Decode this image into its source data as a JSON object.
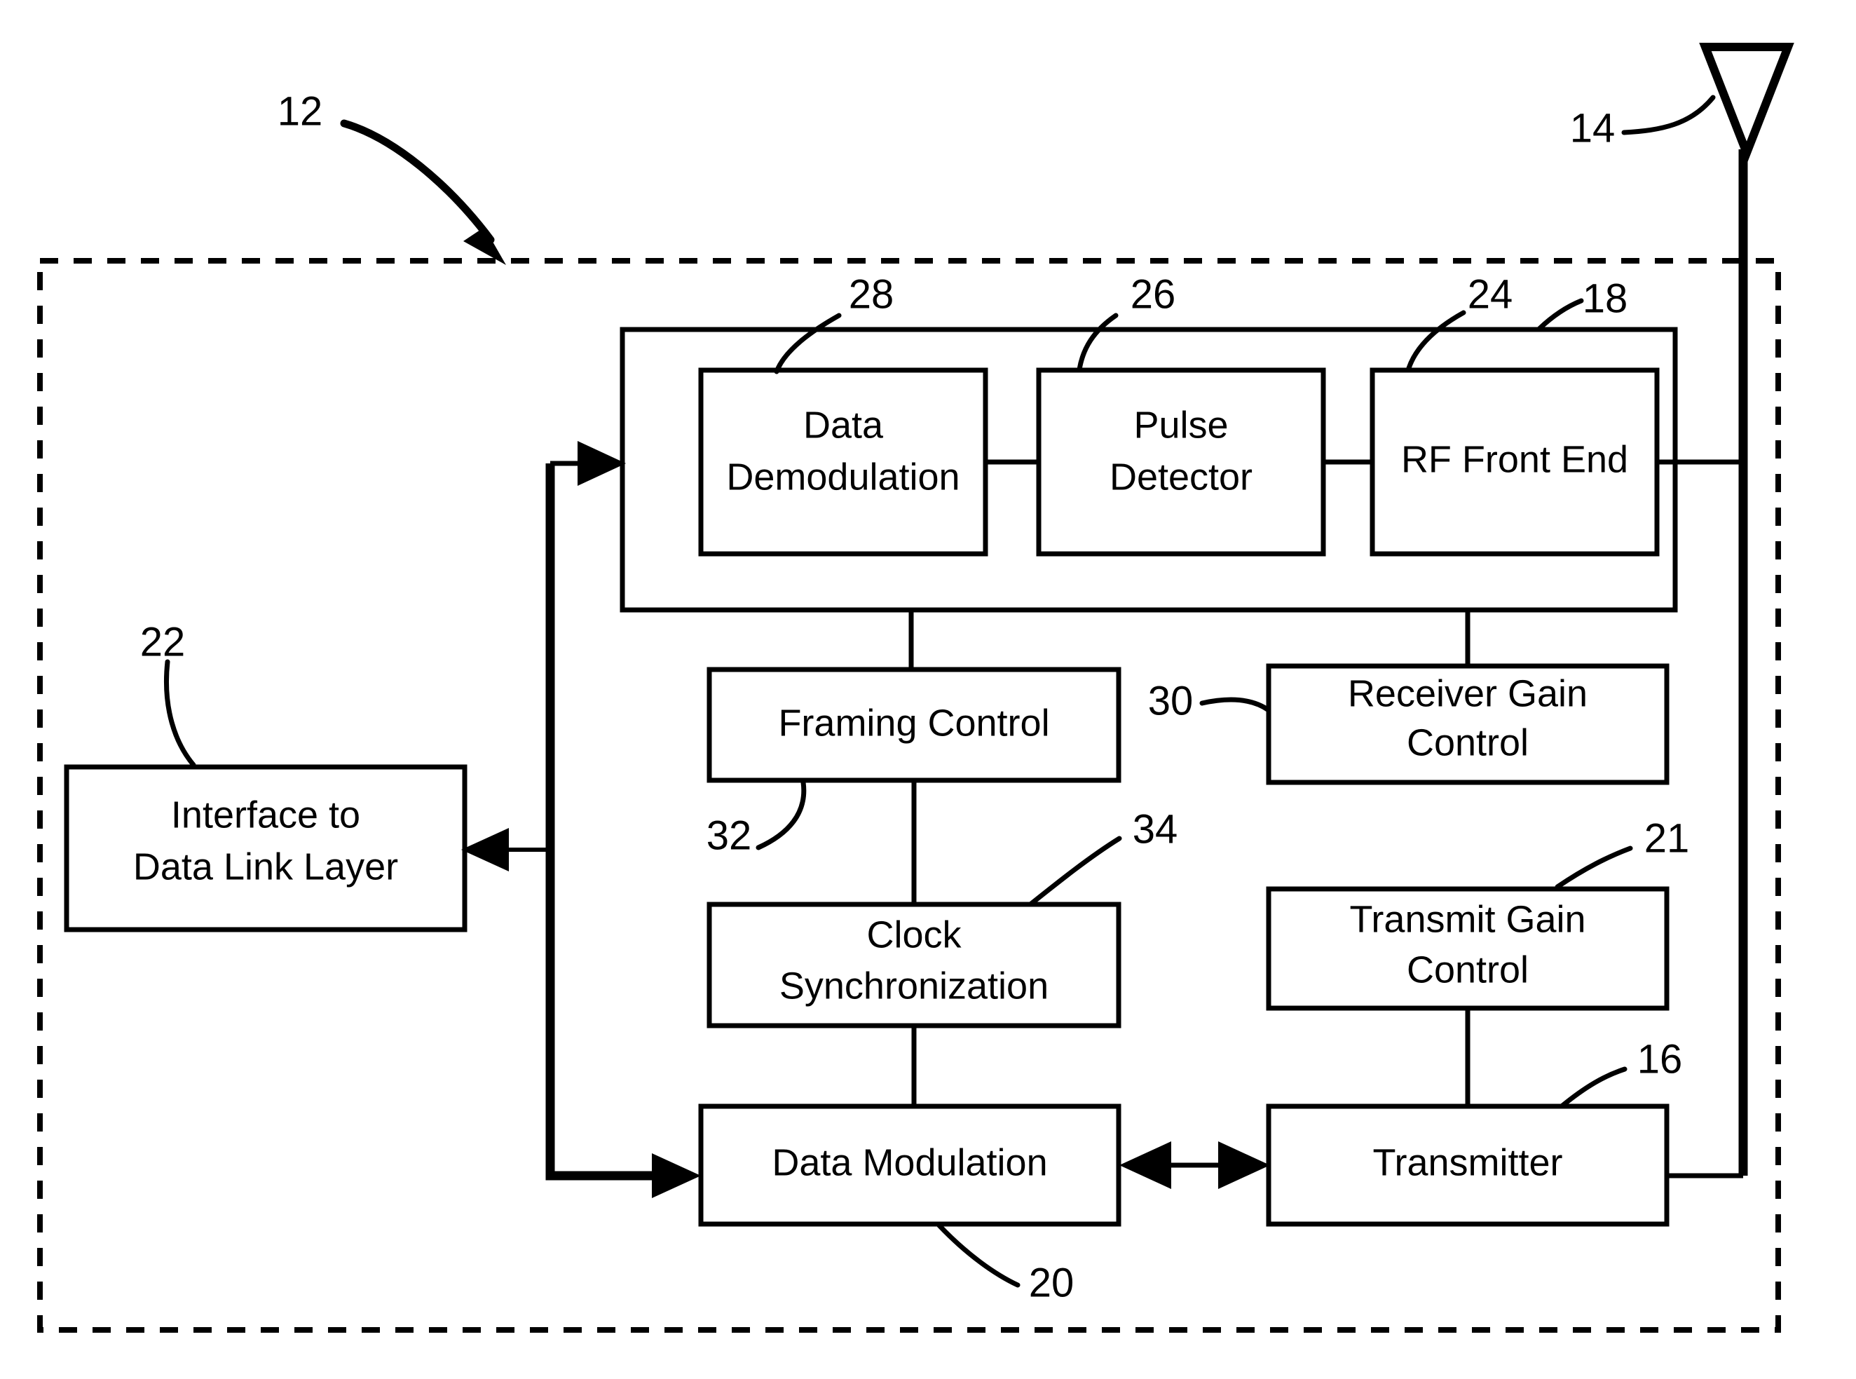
{
  "figure": {
    "type": "patent-block-diagram",
    "background_color": "#ffffff",
    "line_color": "#000000"
  },
  "blocks": {
    "data_demodulation": {
      "label_line1": "Data",
      "label_line2": "Demodulation"
    },
    "pulse_detector": {
      "label_line1": "Pulse",
      "label_line2": "Detector"
    },
    "rf_front_end": {
      "label_line1": "RF Front End",
      "label_line2": ""
    },
    "framing_control": {
      "label_line1": "Framing Control",
      "label_line2": ""
    },
    "receiver_gain_control": {
      "label_line1": "Receiver Gain",
      "label_line2": "Control"
    },
    "interface_data_link": {
      "label_line1": "Interface to",
      "label_line2": "Data Link Layer"
    },
    "clock_synchronization": {
      "label_line1": "Clock",
      "label_line2": "Synchronization"
    },
    "transmit_gain_control": {
      "label_line1": "Transmit Gain",
      "label_line2": "Control"
    },
    "data_modulation": {
      "label_line1": "Data Modulation",
      "label_line2": ""
    },
    "transmitter": {
      "label_line1": "Transmitter",
      "label_line2": ""
    }
  },
  "reference_numerals": {
    "system": "12",
    "antenna": "14",
    "transmitter": "16",
    "receiver_unit": "18",
    "data_modulation": "20",
    "transmit_gain_control": "21",
    "interface_data_link": "22",
    "rf_front_end": "24",
    "pulse_detector": "26",
    "data_demodulation": "28",
    "receiver_gain_control": "30",
    "framing_control": "32",
    "clock_synchronization": "34"
  }
}
